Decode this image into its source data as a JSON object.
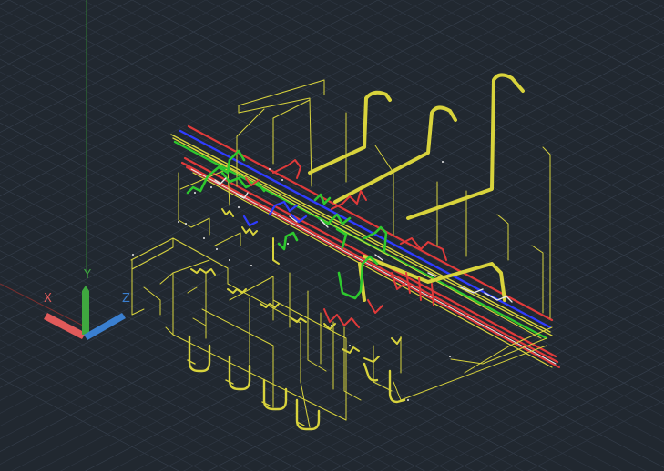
{
  "viewport": {
    "background": "#212830",
    "grid_color": "#2e3642",
    "grid_major_color": "#343d4a"
  },
  "ucs_icon": {
    "x_label": "X",
    "y_label": "Y",
    "z_label": "Z",
    "x_color": "#e05a5a",
    "y_color": "#3fa83f",
    "z_color": "#3a7fd0"
  },
  "model": {
    "pipe_colors": {
      "yellow": "#d8d33c",
      "red": "#e03a3a",
      "blue": "#2f3cff",
      "green": "#2ec82e",
      "white": "#e8e8e8"
    }
  }
}
